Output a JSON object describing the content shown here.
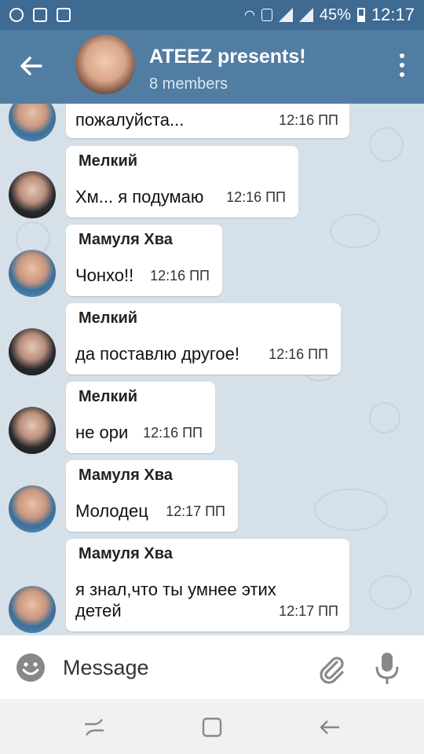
{
  "status_bar": {
    "battery": "45%",
    "time": "12:17",
    "icons": [
      "chrome-icon",
      "gallery-icon",
      "note-icon",
      "wifi-icon",
      "sim-icon",
      "signal-icon",
      "signal-icon",
      "battery-icon"
    ]
  },
  "header": {
    "title": "ATEEZ presents!",
    "subtitle": "8 members",
    "back_icon": "arrow-left-icon",
    "menu_icon": "more-vertical-icon"
  },
  "messages": [
    {
      "sender": "",
      "lines": [
        "пожалуйста..."
      ],
      "time": "12:16 ПП",
      "avatar": "a"
    },
    {
      "sender": "Мелкий",
      "lines": [
        "Хм... я подумаю"
      ],
      "time": "12:16 ПП",
      "avatar": "b"
    },
    {
      "sender": "Мамуля Хва",
      "lines": [
        "Чонхо!!"
      ],
      "time": "12:16 ПП",
      "avatar": "a"
    },
    {
      "sender": "Мелкий",
      "lines": [
        "да поставлю другое!"
      ],
      "time": "12:16 ПП",
      "avatar": "b"
    },
    {
      "sender": "Мелкий",
      "lines": [
        "не ори"
      ],
      "time": "12:16 ПП",
      "avatar": "b"
    },
    {
      "sender": "Мамуля Хва",
      "lines": [
        "Молодец"
      ],
      "time": "12:17 ПП",
      "avatar": "a"
    },
    {
      "sender": "Мамуля Хва",
      "lines": [
        "я знал,что ты умнее этих",
        "детей"
      ],
      "time": "12:17 ПП",
      "avatar": "a"
    }
  ],
  "input": {
    "placeholder": "Message"
  },
  "colors": {
    "status_bar": "#3f6a92",
    "header": "#517da2",
    "chat_background": "#d6e0e9"
  }
}
